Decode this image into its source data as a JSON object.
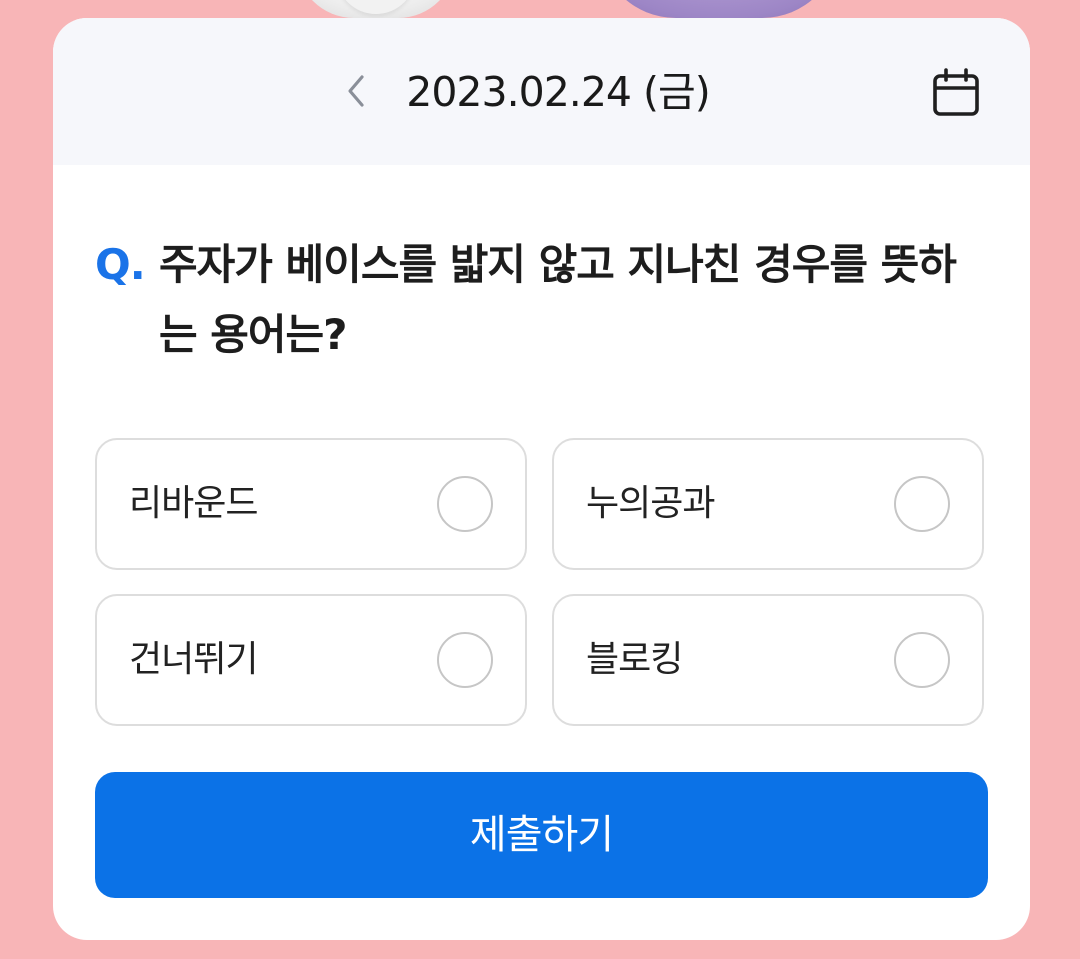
{
  "header": {
    "date": "2023.02.24 (금)",
    "prev_icon": "chevron-left-icon",
    "calendar_icon": "calendar-icon"
  },
  "question": {
    "prefix": "Q.",
    "text": "주자가 베이스를 밟지 않고 지나친 경우를 뜻하는 용어는?"
  },
  "options": [
    {
      "label": "리바운드",
      "selected": false
    },
    {
      "label": "누의공과",
      "selected": false
    },
    {
      "label": "건너뛰기",
      "selected": false
    },
    {
      "label": "블로킹",
      "selected": false
    }
  ],
  "submit": {
    "label": "제출하기"
  },
  "colors": {
    "background": "#f8b5b7",
    "accent": "#0b72e7",
    "question_prefix": "#1a73e8",
    "header_bg": "#f6f7fb"
  }
}
